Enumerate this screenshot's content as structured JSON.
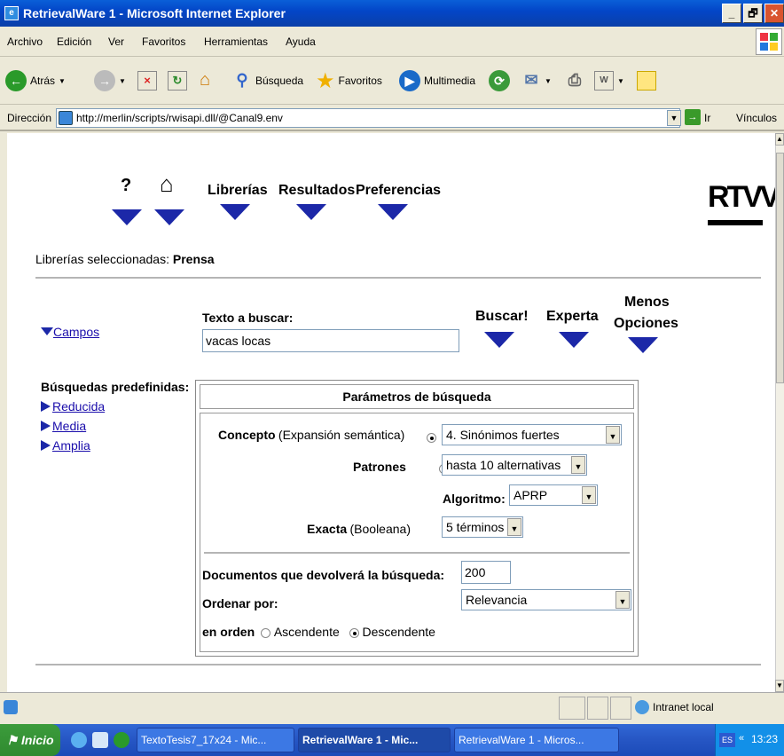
{
  "window": {
    "title": "RetrievalWare 1 - Microsoft Internet Explorer",
    "min": "_",
    "max": "🗗",
    "close": "✕"
  },
  "menu": [
    "Archivo",
    "Edición",
    "Ver",
    "Favoritos",
    "Herramientas",
    "Ayuda"
  ],
  "toolbar": {
    "back": "Atrás",
    "search": "Búsqueda",
    "favorites": "Favoritos",
    "media": "Multimedia"
  },
  "address": {
    "label": "Dirección",
    "url": "http://merlin/scripts/rwisapi.dll/@Canal9.env",
    "go": "Ir",
    "links": "Vínculos"
  },
  "page": {
    "nav": {
      "help": "?",
      "home": "⌂",
      "libraries": "Librerías",
      "results": "Resultados",
      "preferences": "Preferencias"
    },
    "logo": "RTVV",
    "selected_label": "Librerías seleccionadas:",
    "selected_value": "Prensa",
    "campos": "Campos",
    "search_text_label": "Texto a buscar:",
    "search_text_value": "vacas locas",
    "buscar": "Buscar!",
    "experta": "Experta",
    "menos_line1": "Menos",
    "menos_line2": "Opciones",
    "predefined_label": "Búsquedas predefinidas:",
    "predefined": [
      "Reducida",
      "Media",
      "Amplia"
    ],
    "params": {
      "title": "Parámetros de búsqueda",
      "concepto_b": "Concepto",
      "concepto_rest": "(Expansión semántica)",
      "concepto_value": "4. Sinónimos fuertes",
      "patrones": "Patrones",
      "patrones_value": "hasta 10 alternativas",
      "algoritmo": "Algoritmo:",
      "algoritmo_value": "APRP",
      "exacta_b": "Exacta",
      "exacta_rest": "(Booleana)",
      "exacta_value": "5 términos",
      "docs_label": "Documentos que devolverá la búsqueda:",
      "docs_value": "200",
      "order_label": "Ordenar por:",
      "order_value": "Relevancia",
      "en_orden": "en orden",
      "asc": "Ascendente",
      "desc": "Descendente"
    }
  },
  "status": {
    "zone": "Intranet local"
  },
  "taskbar": {
    "start": "Inicio",
    "tasks": [
      "TextoTesis7_17x24 - Mic...",
      "RetrievalWare 1 - Mic...",
      "RetrievalWare 1 - Micros..."
    ],
    "lang": "ES",
    "clock": "13:23"
  }
}
